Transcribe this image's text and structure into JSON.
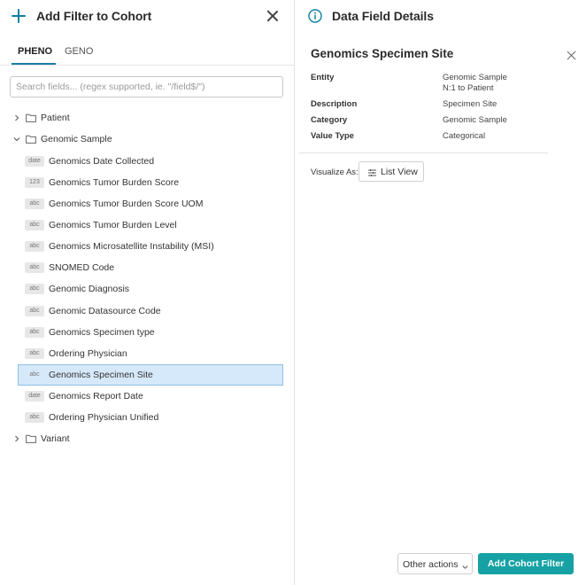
{
  "left_panel": {
    "title": "Add Filter to Cohort",
    "tabs": [
      {
        "label": "PHENO",
        "active": true
      },
      {
        "label": "GENO",
        "active": false
      }
    ],
    "search": {
      "placeholder": "Search fields... (regex supported, ie. \"/field$/\")",
      "value": ""
    },
    "tree": {
      "patient": {
        "label": "Patient",
        "expanded": false
      },
      "genomic_sample": {
        "label": "Genomic Sample",
        "expanded": true,
        "fields": [
          {
            "type": "date",
            "label": "Genomics Date Collected"
          },
          {
            "type": "123",
            "label": "Genomics Tumor Burden Score"
          },
          {
            "type": "abc",
            "label": "Genomics Tumor Burden Score UOM"
          },
          {
            "type": "abc",
            "label": "Genomics Tumor Burden Level"
          },
          {
            "type": "abc",
            "label": "Genomics Microsatellite Instability (MSI)"
          },
          {
            "type": "abc",
            "label": "SNOMED Code"
          },
          {
            "type": "abc",
            "label": "Genomic Diagnosis"
          },
          {
            "type": "abc",
            "label": "Genomic Datasource Code"
          },
          {
            "type": "abc",
            "label": "Genomics Specimen type"
          },
          {
            "type": "abc",
            "label": "Ordering Physician"
          },
          {
            "type": "abc",
            "label": "Genomics Specimen Site",
            "selected": true
          },
          {
            "type": "date",
            "label": "Genomics Report Date"
          },
          {
            "type": "abc",
            "label": "Ordering Physician Unified"
          }
        ]
      },
      "variant": {
        "label": "Variant",
        "expanded": false
      }
    }
  },
  "right_panel": {
    "title": "Data Field Details",
    "field_name": "Genomics Specimen Site",
    "details": {
      "entity": {
        "label": "Entity",
        "value_line1": "Genomic Sample",
        "value_line2": "N:1 to Patient"
      },
      "description": {
        "label": "Description",
        "value": "Specimen Site"
      },
      "category": {
        "label": "Category",
        "value": "Genomic Sample"
      },
      "value_type": {
        "label": "Value Type",
        "value": "Categorical"
      }
    },
    "visualize_label": "Visualize As:",
    "visualize_button": "List View"
  },
  "footer": {
    "other_actions": "Other actions",
    "add_button": "Add Cohort Filter"
  },
  "colors": {
    "accent": "#0c7ea0",
    "primary_button": "#16a2a4",
    "selected_row": "#d6e9fa",
    "selected_border": "#8ebfe6"
  },
  "icons": [
    "plus-icon",
    "close-icon",
    "chevron-right-icon",
    "chevron-down-icon",
    "folder-icon",
    "info-icon",
    "list-view-icon"
  ]
}
